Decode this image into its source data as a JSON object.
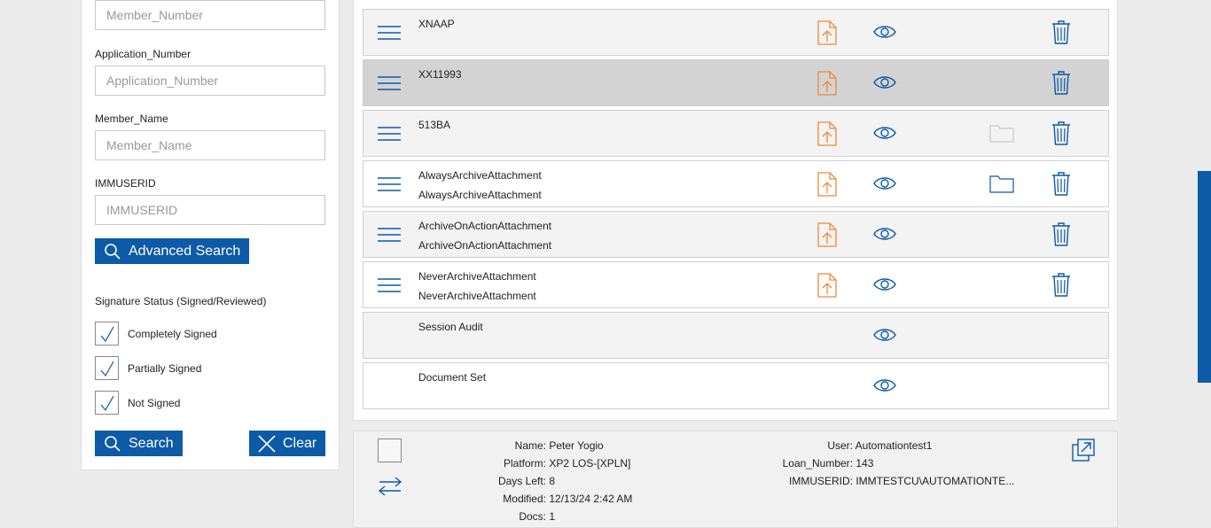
{
  "search": {
    "member_number_placeholder": "Member_Number",
    "application_number_label": "Application_Number",
    "application_number_placeholder": "Application_Number",
    "member_name_label": "Member_Name",
    "member_name_placeholder": "Member_Name",
    "immuserid_label": "IMMUSERID",
    "immuserid_placeholder": "IMMUSERID",
    "advanced_search_label": "Advanced Search",
    "signature_status_label": "Signature Status (Signed/Reviewed)",
    "checkboxes": [
      {
        "label": "Completely Signed",
        "checked": true
      },
      {
        "label": "Partially Signed",
        "checked": true
      },
      {
        "label": "Not Signed",
        "checked": true
      }
    ],
    "search_label": "Search",
    "clear_label": "Clear"
  },
  "documents": [
    {
      "title": "XNAAP",
      "subtitle": "",
      "menu": true,
      "upload": true,
      "view": true,
      "folder": null,
      "delete": true,
      "style": "shade"
    },
    {
      "title": "XX11993",
      "subtitle": "",
      "menu": true,
      "upload": true,
      "view": true,
      "folder": null,
      "delete": true,
      "style": "selected"
    },
    {
      "title": "513BA",
      "subtitle": "",
      "menu": true,
      "upload": true,
      "view": true,
      "folder": "disabled",
      "delete": true,
      "style": "shade"
    },
    {
      "title": "AlwaysArchiveAttachment",
      "subtitle": "AlwaysArchiveAttachment",
      "menu": true,
      "upload": true,
      "view": true,
      "folder": "active",
      "delete": true,
      "style": "plain"
    },
    {
      "title": "ArchiveOnActionAttachment",
      "subtitle": "ArchiveOnActionAttachment",
      "menu": true,
      "upload": true,
      "view": true,
      "folder": null,
      "delete": true,
      "style": "shade"
    },
    {
      "title": "NeverArchiveAttachment",
      "subtitle": "NeverArchiveAttachment",
      "menu": true,
      "upload": true,
      "view": true,
      "folder": null,
      "delete": true,
      "style": "plain"
    },
    {
      "title": "Session Audit",
      "subtitle": "",
      "menu": false,
      "upload": false,
      "view": true,
      "folder": null,
      "delete": false,
      "style": "shade"
    },
    {
      "title": "Document Set",
      "subtitle": "",
      "menu": false,
      "upload": false,
      "view": true,
      "folder": null,
      "delete": false,
      "style": "plain"
    }
  ],
  "details": {
    "left": [
      {
        "key": "Name:",
        "value": "Peter Yogio"
      },
      {
        "key": "Platform:",
        "value": "XP2 LOS-[XPLN]"
      },
      {
        "key": "Days Left:",
        "value": "8"
      },
      {
        "key": "Modified:",
        "value": "12/13/24 2:42 AM"
      },
      {
        "key": "Docs:",
        "value": "1"
      }
    ],
    "right": [
      {
        "key": "User:",
        "value": "Automationtest1"
      },
      {
        "key": "Loan_Number:",
        "value": "143"
      },
      {
        "key": "IMMUSERID:",
        "value": "IMMTESTCU\\AUTOMATIONTE..."
      }
    ]
  },
  "colors": {
    "accent": "#0d5aa7",
    "upload": "#f0883a",
    "folder_disabled": "#c8c8c8"
  }
}
